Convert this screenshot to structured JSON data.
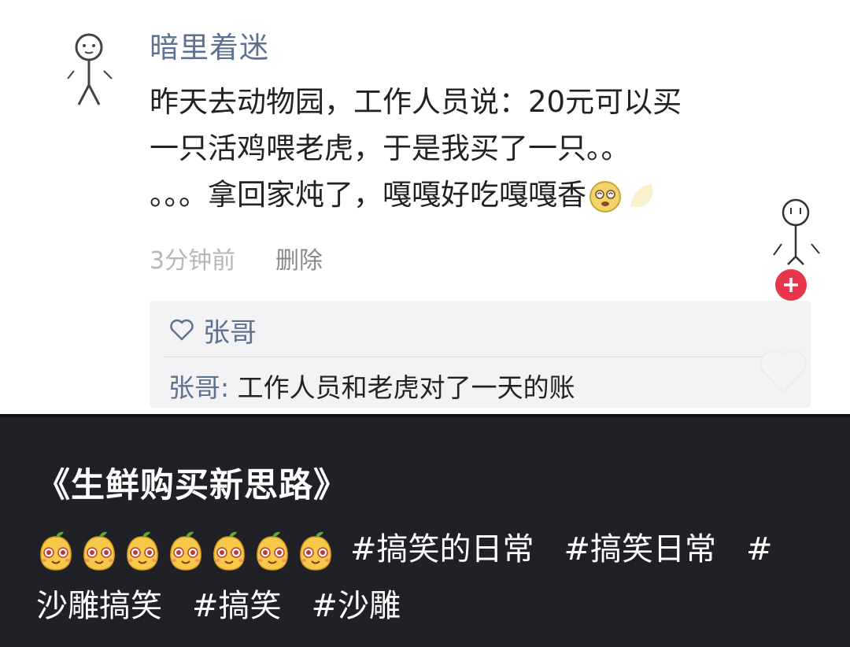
{
  "comment": {
    "username": "暗里着迷",
    "text_lines": [
      "昨天去动物园，工作人员说：20元可以买",
      "一只活鸡喂老虎，于是我买了一只。。",
      "。。。拿回家炖了，嘎嘎好吃嘎嘎香"
    ],
    "time": "3分钟前",
    "delete_label": "删除"
  },
  "reply": {
    "liked_by": "张哥",
    "author": "张哥:",
    "text": "工作人员和老虎对了一天的账"
  },
  "post": {
    "title": "《生鲜购买新思路》",
    "emoji_count": 7,
    "tags_line1": [
      "#搞笑的日常",
      "#搞笑日常",
      "#"
    ],
    "tags_line2": [
      "沙雕搞笑",
      "#搞笑",
      "#沙雕"
    ]
  },
  "icons": {
    "avatar": "stick-figure-icon",
    "sticker": "stick-figure-sticker-icon",
    "add": "plus-icon",
    "like": "heart-outline-icon",
    "emoji": "mango-face-emoji-icon",
    "inline_emoji": "dizzy-face-emoji-icon"
  },
  "colors": {
    "username": "#5d7290",
    "accent_red": "#e8354b",
    "dark_bg": "#1f2127"
  }
}
